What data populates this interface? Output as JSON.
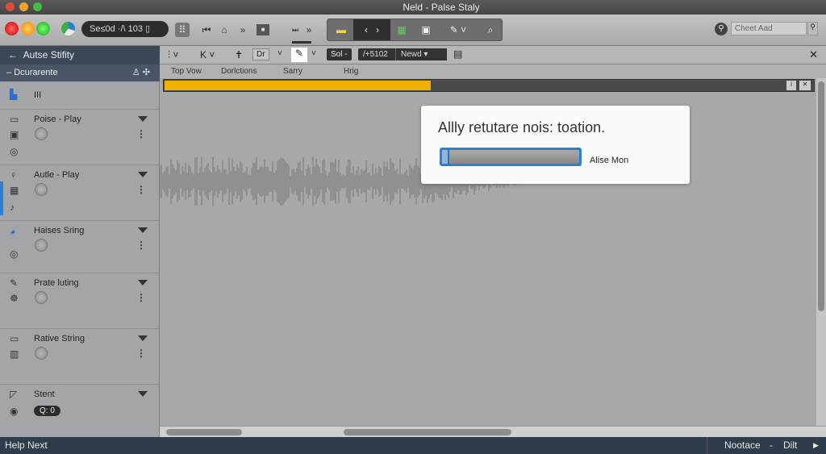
{
  "window": {
    "title": "Neld - Palse Staly"
  },
  "toolbar": {
    "session_pill": "Se≤0d ·/\\   103 ▯",
    "search_placeholder": "Cheet Aad",
    "icons": [
      "grid-icon",
      "skip-back-icon",
      "tag-icon",
      "fast-forward-icon",
      "stop-icon",
      "skip-icon",
      "forward-icon",
      "note-icon",
      "back-icon",
      "forward-nav-icon",
      "spreadsheet-icon",
      "document-icon",
      "brush-icon",
      "zoom-icon",
      "key-icon"
    ]
  },
  "sidebar": {
    "title": "Autse Stifity",
    "subheader": "Dcurarente",
    "top_label": "III",
    "items": [
      {
        "label": "Poise - Play"
      },
      {
        "label": "Autle - Play"
      },
      {
        "label": "Haises Sring"
      },
      {
        "label": "Prate luting"
      },
      {
        "label": "Rative String"
      },
      {
        "label": "Stent",
        "badge": "Q: 0"
      }
    ]
  },
  "editor": {
    "toolbar": {
      "drop1": "Dr",
      "sel": "Sol -",
      "time": "/+5102",
      "mode": "Newd"
    },
    "tabs": [
      "Top Vow",
      "Dorlctions",
      "Sarry",
      "Hrig"
    ],
    "track_progress_percent": 41
  },
  "dialog": {
    "title": "Allly retutare nois: toation.",
    "progress_percent": 5,
    "name": "Alise Mon"
  },
  "status": {
    "left": "Help Next",
    "right1": "Nootace",
    "sep": "-",
    "right2": "Dilt"
  },
  "colors": {
    "accent": "#2a7fd4",
    "track": "#f0b000",
    "statusbar": "#2f3c4b"
  }
}
